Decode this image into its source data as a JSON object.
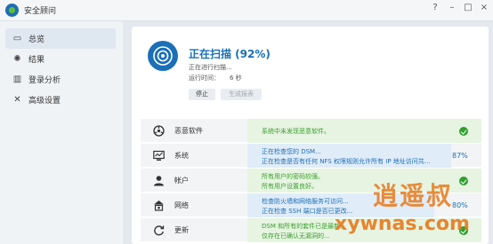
{
  "window": {
    "title": "安全顾问",
    "help_symbol": "?",
    "minimize_symbol": "–",
    "maximize_symbol": "□",
    "close_symbol": "×"
  },
  "sidebar": {
    "items": [
      {
        "label": "总览",
        "icon": "overview-icon",
        "icon_glyph": "▭",
        "active": true
      },
      {
        "label": "结果",
        "icon": "results-icon",
        "icon_glyph": "✺",
        "active": false
      },
      {
        "label": "登录分析",
        "icon": "login-analysis-icon",
        "icon_glyph": "▥",
        "active": false
      },
      {
        "label": "高级设置",
        "icon": "advanced-settings-icon",
        "icon_glyph": "✕",
        "active": false
      }
    ]
  },
  "scan": {
    "title": "正在扫描 (92%)",
    "status": "正在进行扫描...",
    "runtime_label": "运行时间：",
    "runtime_value": "6 秒",
    "stop_label": "停止",
    "report_label": "生成报表"
  },
  "checks": [
    {
      "label": "恶意软件",
      "icon": "malware-icon",
      "lines": [
        "系统中未发现恶意软件。"
      ],
      "state": "done",
      "fill_percent": 100,
      "percent_text": ""
    },
    {
      "label": "系统",
      "icon": "system-icon",
      "lines": [
        "正在检查您的 DSM...",
        "正在检查是否有任何 NFS 权限规则允许所有 IP 地址访问共..."
      ],
      "state": "running",
      "fill_percent": 87,
      "percent_text": "87%"
    },
    {
      "label": "帐户",
      "icon": "account-icon",
      "lines": [
        "所有用户的密码较强。",
        "所有用户设置良好。"
      ],
      "state": "done",
      "fill_percent": 100,
      "percent_text": ""
    },
    {
      "label": "网络",
      "icon": "network-icon",
      "lines": [
        "检查防火墙和网络服务可访问...",
        "正在检查 SSH 端口是否已更改..."
      ],
      "state": "running",
      "fill_percent": 80,
      "percent_text": "80%"
    },
    {
      "label": "更新",
      "icon": "update-icon",
      "lines": [
        "DSM 和所有的套件已是最新。",
        "仅存在已确认无漏洞的..."
      ],
      "state": "done",
      "fill_percent": 100,
      "percent_text": ""
    }
  ],
  "watermark": {
    "text": "逍遥叔",
    "url": "xywnas.com"
  },
  "colors": {
    "accent": "#1a6fb8",
    "done_fill": "#e6f4e1",
    "running_fill": "#e0ecf8",
    "success": "#2f9e2f",
    "watermark": "#e87a1c"
  }
}
